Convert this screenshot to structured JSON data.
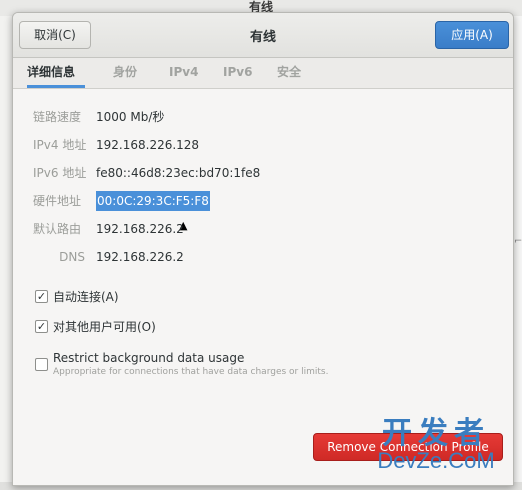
{
  "background_window": {
    "title": "有线"
  },
  "header": {
    "cancel_label": "取消(C)",
    "title": "有线",
    "apply_label": "应用(A)"
  },
  "tabs": [
    {
      "label": "详细信息",
      "active": true
    },
    {
      "label": "身份",
      "active": false
    },
    {
      "label": "IPv4",
      "active": false
    },
    {
      "label": "IPv6",
      "active": false
    },
    {
      "label": "安全",
      "active": false
    }
  ],
  "details": {
    "link_speed": {
      "label": "链路速度",
      "value": "1000 Mb/秒"
    },
    "ipv4": {
      "label": "IPv4 地址",
      "value": "192.168.226.128"
    },
    "ipv6": {
      "label": "IPv6 地址",
      "value": "fe80::46d8:23ec:bd70:1fe8"
    },
    "hw": {
      "label": "硬件地址",
      "value": "00:0C:29:3C:F5:F8"
    },
    "route": {
      "label": "默认路由",
      "value": "192.168.226.2"
    },
    "dns": {
      "label": "DNS",
      "value": "192.168.226.2"
    }
  },
  "options": {
    "auto_connect": {
      "label": "自动连接(A)",
      "checked": true
    },
    "all_users": {
      "label": "对其他用户可用(O)",
      "checked": true
    },
    "restrict_bg": {
      "label": "Restrict background data usage",
      "sub": "Appropriate for connections that have data charges or limits.",
      "checked": false
    }
  },
  "remove_button_label": "Remove Connection Profile",
  "watermark": {
    "top": "开发者",
    "bottom": "DevZe.CoM"
  },
  "colors": {
    "accent": "#4a90d9",
    "destructive": "#e03430",
    "watermark": "#3a7dbf"
  }
}
